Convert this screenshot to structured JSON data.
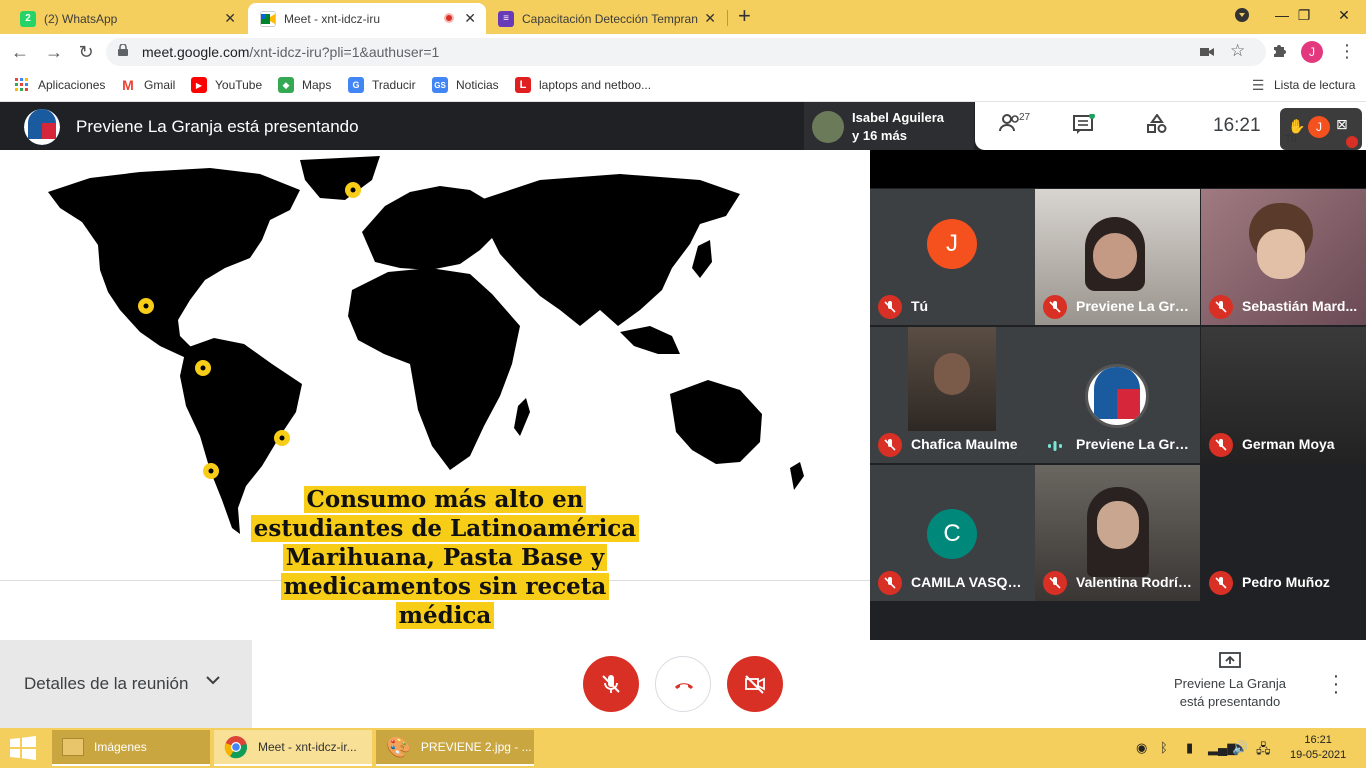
{
  "browser": {
    "tabs": [
      {
        "title": "(2) WhatsApp",
        "badge": "2"
      },
      {
        "title": "Meet - xnt-idcz-iru"
      },
      {
        "title": "Capacitación Detección Tempran"
      }
    ],
    "url_host": "meet.google.com",
    "url_path": "/xnt-idcz-iru?pli=1&authuser=1",
    "profile_initial": "J",
    "accent": "#f4cf5e"
  },
  "bookmarks": {
    "items": [
      "Aplicaciones",
      "Gmail",
      "YouTube",
      "Maps",
      "Traducir",
      "Noticias",
      "laptops and netboo..."
    ],
    "reading_list": "Lista de lectura"
  },
  "meet": {
    "presenting_title": "Previene La Granja está presentando",
    "pip_name": "Isabel Aguilera",
    "pip_more": "y 16 más",
    "people_count": "27",
    "time": "16:21",
    "self_label": "Tú",
    "self_initial": "J"
  },
  "slide": {
    "caption_lines": [
      "Consumo más alto en",
      "estudiantes de Latinoamérica",
      "Marihuana, Pasta Base y",
      "medicamentos sin receta",
      "médica"
    ],
    "highlight_color": "#f8cd17"
  },
  "participants": [
    {
      "name": "Tú",
      "initial": "J",
      "avatar_color": "#f4511e"
    },
    {
      "name": "Previene La Gran..."
    },
    {
      "name": "Sebastián Mard..."
    },
    {
      "name": "Chafica Maulme"
    },
    {
      "name": "Previene La Gran..."
    },
    {
      "name": "German Moya"
    },
    {
      "name": "CAMILA VASQU...",
      "initial": "C",
      "avatar_color": "#00897b"
    },
    {
      "name": "Valentina Rodríg..."
    },
    {
      "name": "Pedro Muñoz"
    }
  ],
  "controls": {
    "details_label": "Detalles de la reunión",
    "share_line1": "Previene La Granja",
    "share_line2": "está presentando",
    "danger_color": "#d93025"
  },
  "taskbar": {
    "items": [
      "Imágenes",
      "Meet - xnt-idcz-ir...",
      "PREVIENE 2.jpg - ..."
    ],
    "time": "16:21",
    "date": "19-05-2021"
  }
}
